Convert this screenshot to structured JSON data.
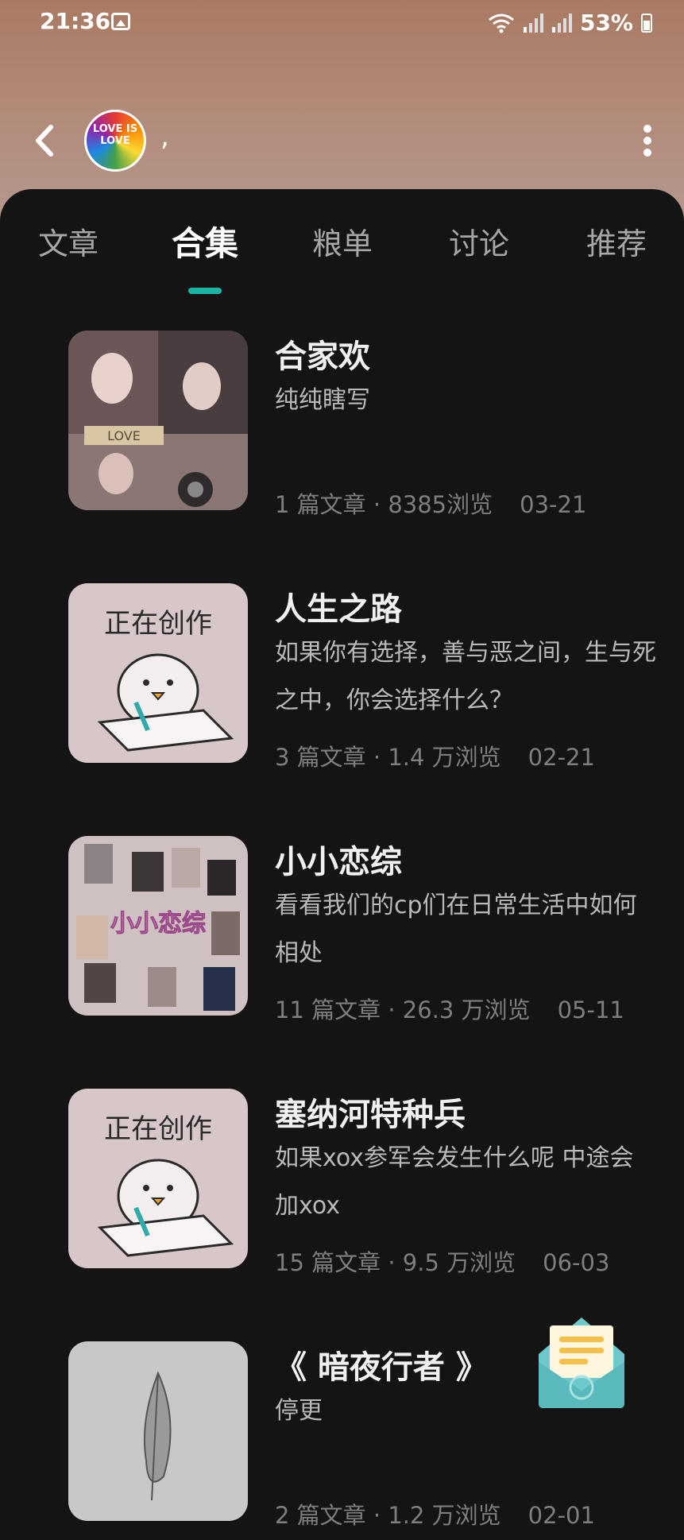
{
  "status_bar": {
    "time": "21:36",
    "battery": "53%"
  },
  "header": {
    "username": ",",
    "avatar_text": "LOVE IS LOVE"
  },
  "tabs": [
    {
      "label": "文章"
    },
    {
      "label": "合集",
      "active": true
    },
    {
      "label": "粮单"
    },
    {
      "label": "讨论"
    },
    {
      "label": "推荐"
    }
  ],
  "collections": [
    {
      "title": "合家欢",
      "desc": "纯纯瞎写",
      "articles": "1 篇文章",
      "views": "8385浏览",
      "date": "03-21",
      "thumb": "photo-collage"
    },
    {
      "title": "人生之路",
      "desc": "如果你有选择，善与恶之间，生与死之中，你会选择什么？",
      "articles": "3 篇文章",
      "views": "1.4 万浏览",
      "date": "02-21",
      "thumb": "writing-chick"
    },
    {
      "title": "小小恋综",
      "desc": "看看我们的cp们在日常生活中如何相处",
      "articles": "11 篇文章",
      "views": "26.3 万浏览",
      "date": "05-11",
      "thumb": "photo-collage"
    },
    {
      "title": "塞纳河特种兵",
      "desc": "如果xox参军会发生什么呢 中途会加xox",
      "articles": "15 篇文章",
      "views": "9.5 万浏览",
      "date": "06-03",
      "thumb": "writing-chick"
    },
    {
      "title": "《 暗夜行者 》",
      "desc": "停更",
      "articles": "2 篇文章",
      "views": "1.2 万浏览",
      "date": "02-01",
      "thumb": "leaf"
    }
  ],
  "thumb_text": {
    "writing": "正在创作",
    "love": "LOVE",
    "variety": "小小恋综"
  }
}
